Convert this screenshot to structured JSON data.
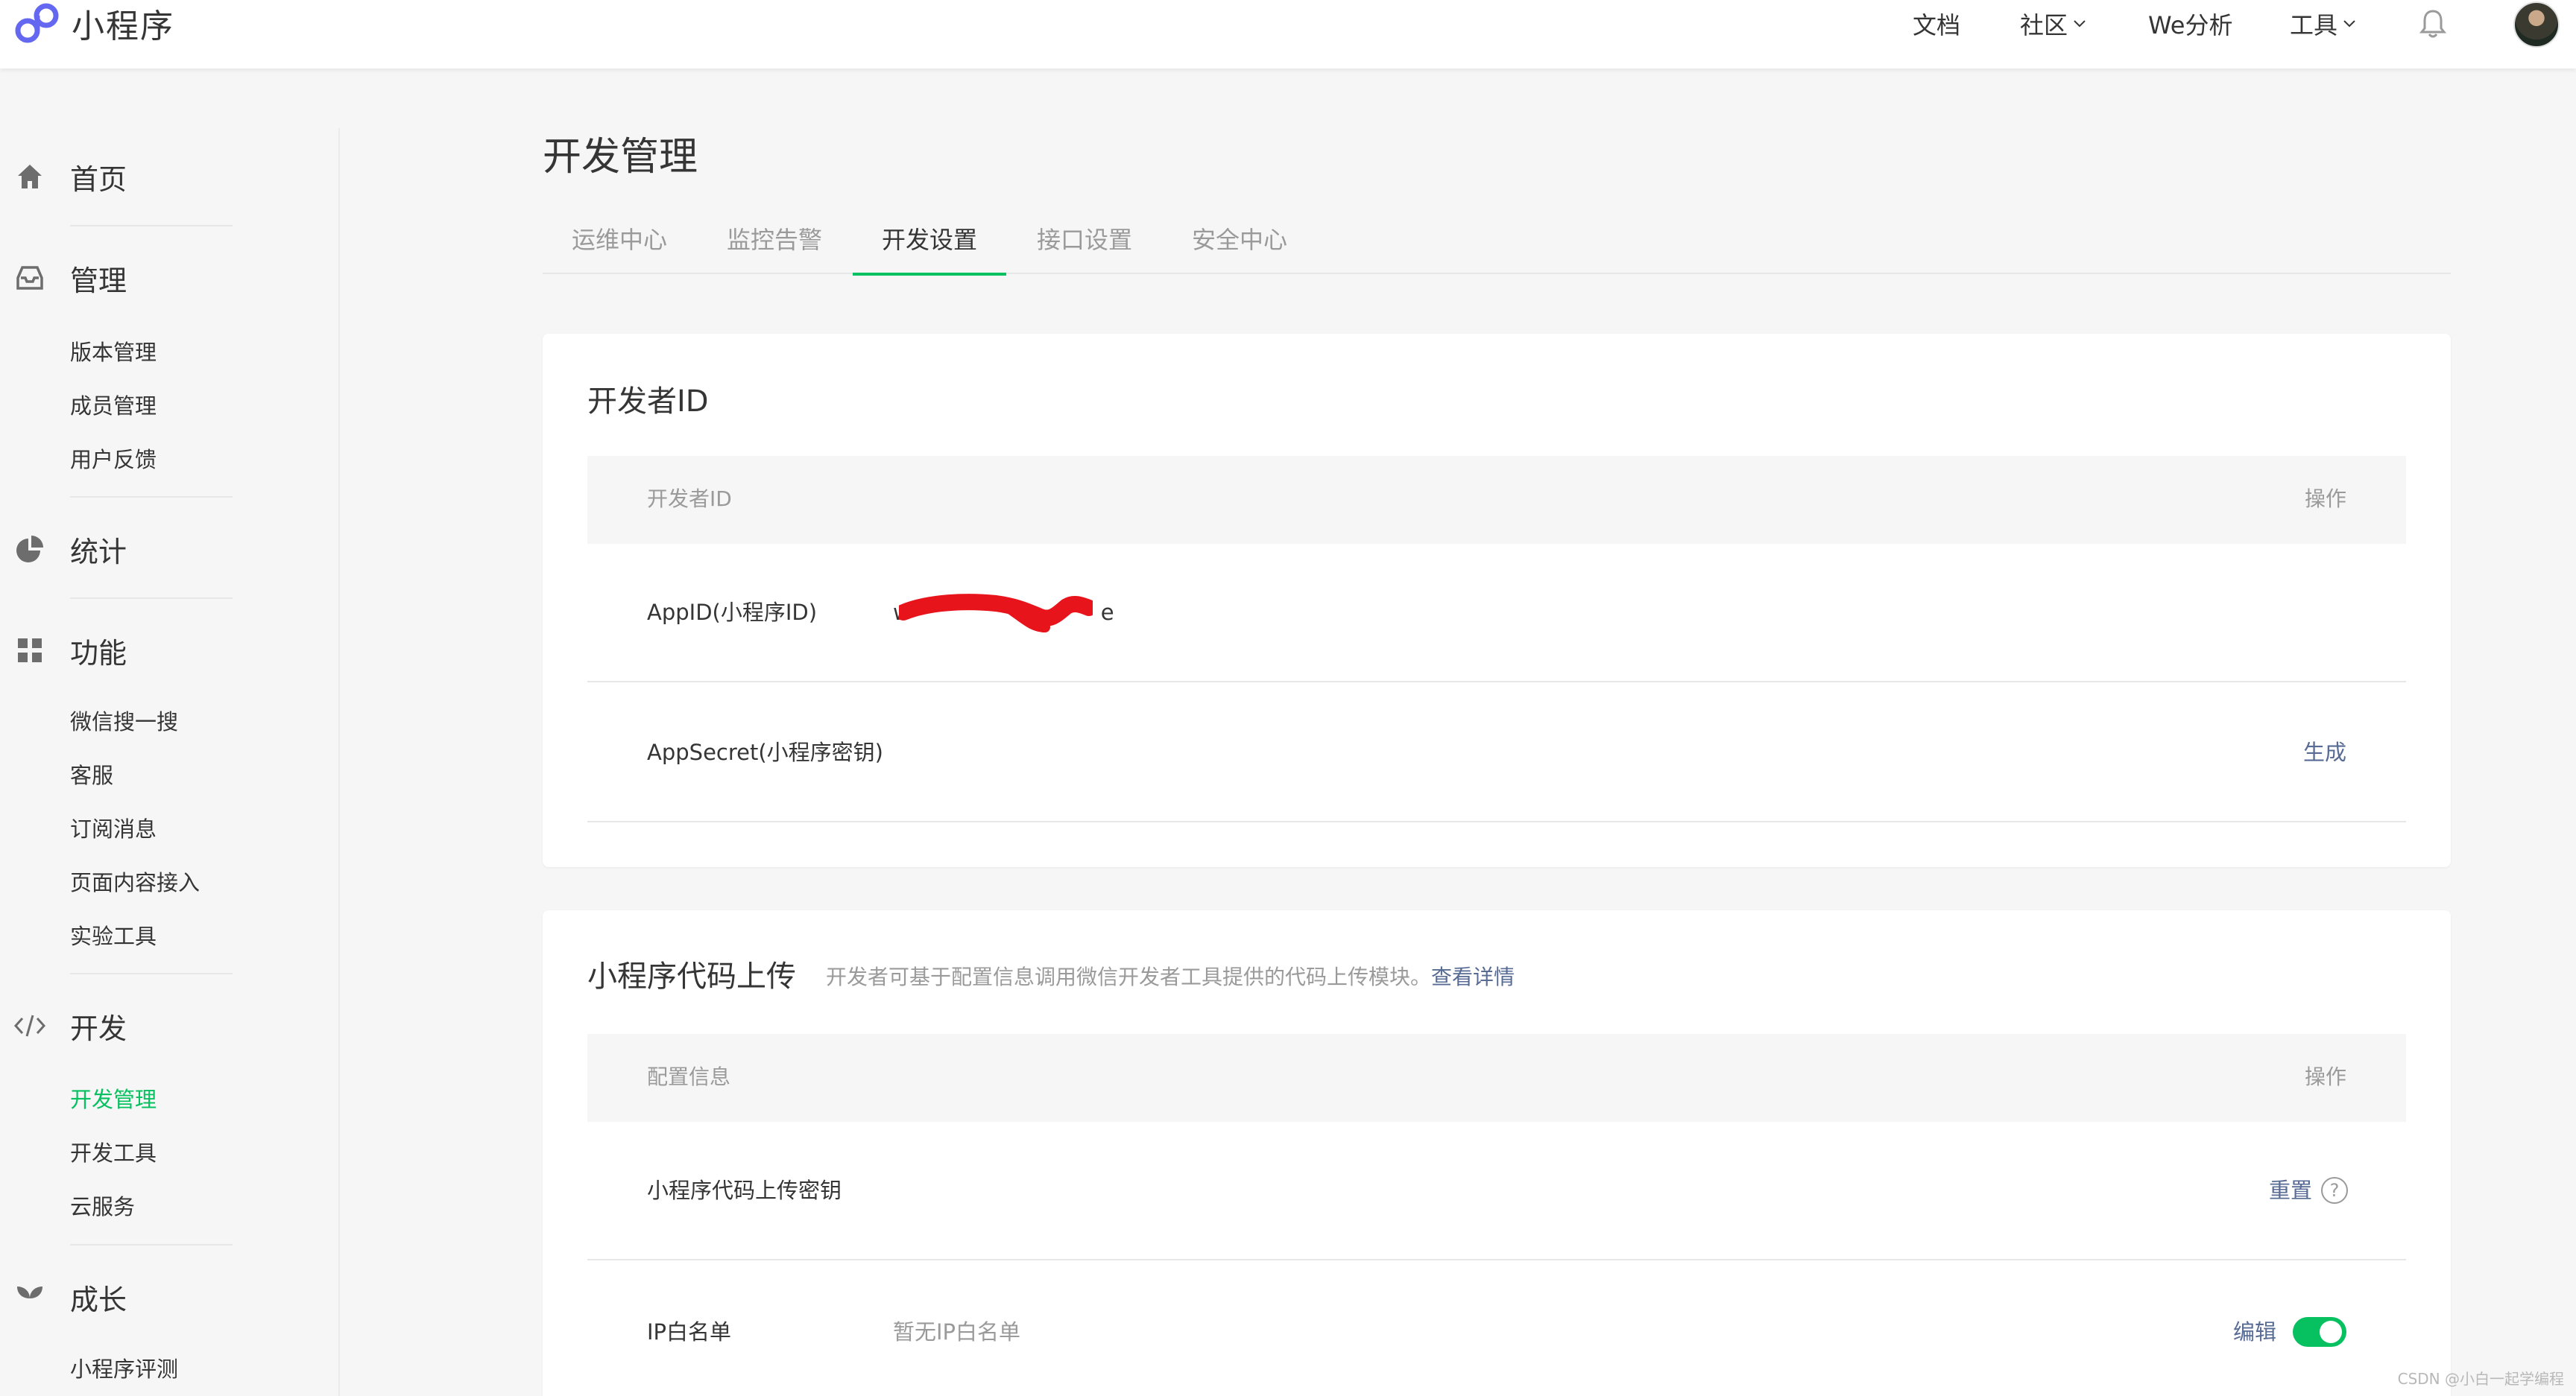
{
  "header": {
    "brand_name": "小程序",
    "nav": [
      {
        "label": "文档"
      },
      {
        "label": "社区"
      },
      {
        "label": "We分析"
      },
      {
        "label": "工具"
      }
    ]
  },
  "sidebar": {
    "home": {
      "label": "首页"
    },
    "manage": {
      "label": "管理",
      "items": [
        {
          "label": "版本管理"
        },
        {
          "label": "成员管理"
        },
        {
          "label": "用户反馈"
        }
      ]
    },
    "stats": {
      "label": "统计"
    },
    "features": {
      "label": "功能",
      "items": [
        {
          "label": "微信搜一搜"
        },
        {
          "label": "客服"
        },
        {
          "label": "订阅消息"
        },
        {
          "label": "页面内容接入"
        },
        {
          "label": "实验工具"
        }
      ]
    },
    "dev": {
      "label": "开发",
      "items": [
        {
          "label": "开发管理",
          "active": true
        },
        {
          "label": "开发工具"
        },
        {
          "label": "云服务"
        }
      ]
    },
    "growth": {
      "label": "成长",
      "items": [
        {
          "label": "小程序评测"
        }
      ]
    }
  },
  "main": {
    "title": "开发管理",
    "tabs": [
      {
        "label": "运维中心"
      },
      {
        "label": "监控告警"
      },
      {
        "label": "开发设置",
        "active": true
      },
      {
        "label": "接口设置"
      },
      {
        "label": "安全中心"
      }
    ],
    "developer_id_card": {
      "title": "开发者ID",
      "header_left": "开发者ID",
      "header_right": "操作",
      "rows": [
        {
          "label": "AppID(小程序ID)",
          "value_start": "w",
          "value_end": "e",
          "redacted": true
        },
        {
          "label": "AppSecret(小程序密钥)",
          "action": "生成"
        }
      ]
    },
    "upload_card": {
      "title": "小程序代码上传",
      "description": "开发者可基于配置信息调用微信开发者工具提供的代码上传模块。",
      "description_link": "查看详情",
      "header_left": "配置信息",
      "header_right": "操作",
      "rows": [
        {
          "label": "小程序代码上传密钥",
          "action": "重置",
          "help": "?"
        },
        {
          "label": "IP白名单",
          "value": "暂无IP白名单",
          "action": "编辑",
          "toggle_on": true
        }
      ]
    }
  },
  "watermark": "CSDN @小白一起学编程",
  "colors": {
    "accent": "#07c160",
    "link": "#576b95",
    "brand": "#6467f0",
    "redaction": "#e8141b"
  }
}
